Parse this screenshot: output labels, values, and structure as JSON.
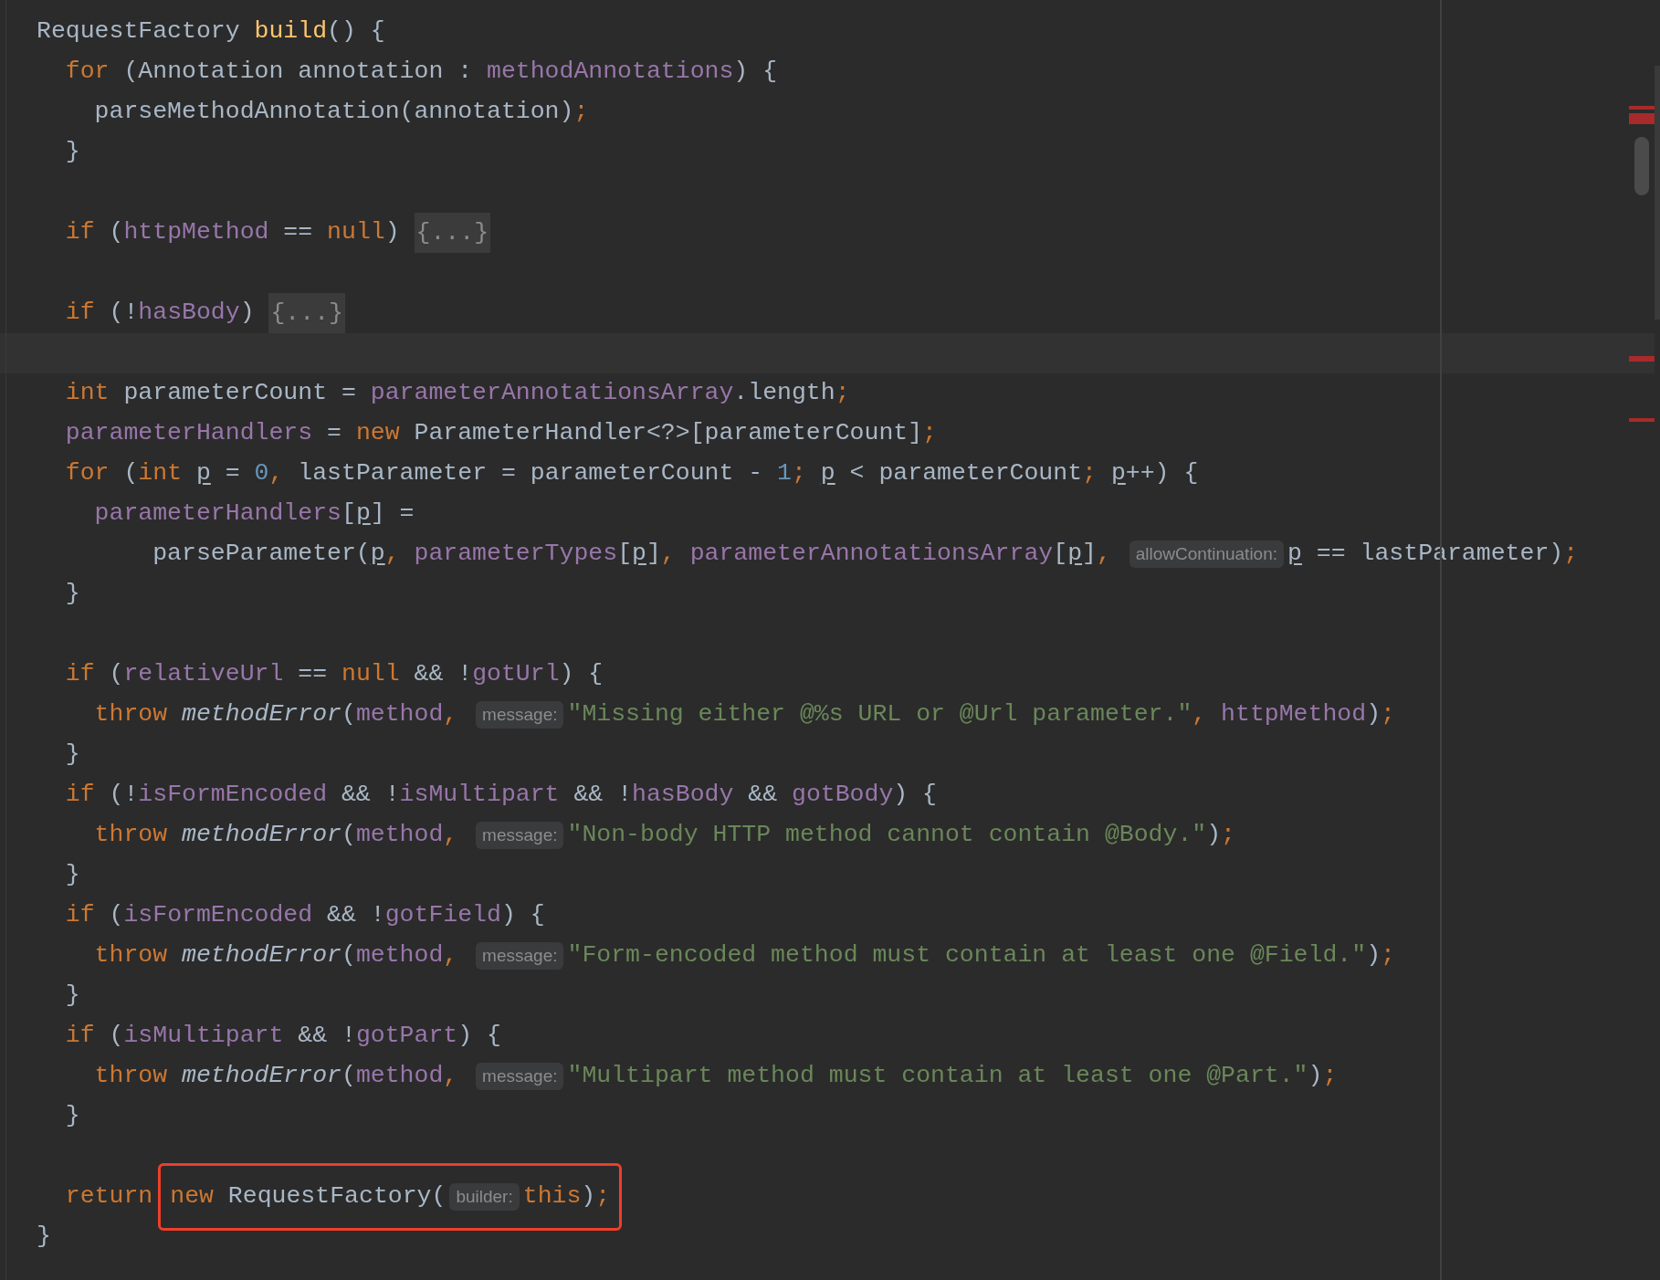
{
  "editor": {
    "lines": [
      {
        "current": false,
        "tokens": [
          {
            "kind": "plain",
            "text": "RequestFactory "
          },
          {
            "kind": "decl",
            "text": "build"
          },
          {
            "kind": "plain",
            "text": "() {"
          }
        ]
      },
      {
        "current": false,
        "tokens": [
          {
            "kind": "kw",
            "text": "  for "
          },
          {
            "kind": "plain",
            "text": "(Annotation annotation : "
          },
          {
            "kind": "field",
            "text": "methodAnnotations"
          },
          {
            "kind": "plain",
            "text": ") {"
          }
        ]
      },
      {
        "current": false,
        "tokens": [
          {
            "kind": "plain",
            "text": "    parseMethodAnnotation(annotation)"
          },
          {
            "kind": "kw",
            "text": ";"
          }
        ]
      },
      {
        "current": false,
        "tokens": [
          {
            "kind": "plain",
            "text": "  }"
          }
        ]
      },
      {
        "current": false
      },
      {
        "current": false,
        "tokens": [
          {
            "kind": "kw",
            "text": "  if "
          },
          {
            "kind": "plain",
            "text": "("
          },
          {
            "kind": "field",
            "text": "httpMethod"
          },
          {
            "kind": "plain",
            "text": " == "
          },
          {
            "kind": "kw",
            "text": "null"
          },
          {
            "kind": "plain",
            "text": ") "
          },
          {
            "kind": "fold",
            "text": "{...}"
          }
        ]
      },
      {
        "current": false
      },
      {
        "current": false,
        "tokens": [
          {
            "kind": "kw",
            "text": "  if "
          },
          {
            "kind": "plain",
            "text": "(!"
          },
          {
            "kind": "field",
            "text": "hasBody"
          },
          {
            "kind": "plain",
            "text": ") "
          },
          {
            "kind": "fold",
            "text": "{...}"
          }
        ]
      },
      {
        "current": true
      },
      {
        "current": false,
        "tokens": [
          {
            "kind": "kw",
            "text": "  int "
          },
          {
            "kind": "plain",
            "text": "parameterCount = "
          },
          {
            "kind": "field",
            "text": "parameterAnnotationsArray"
          },
          {
            "kind": "plain",
            "text": ".length"
          },
          {
            "kind": "kw",
            "text": ";"
          }
        ]
      },
      {
        "current": false,
        "tokens": [
          {
            "kind": "field",
            "text": "  parameterHandlers"
          },
          {
            "kind": "plain",
            "text": " = "
          },
          {
            "kind": "kw",
            "text": "new "
          },
          {
            "kind": "plain",
            "text": "ParameterHandler<?>[parameterCount]"
          },
          {
            "kind": "kw",
            "text": ";"
          }
        ]
      },
      {
        "current": false,
        "tokens": [
          {
            "kind": "kw",
            "text": "  for "
          },
          {
            "kind": "plain",
            "text": "("
          },
          {
            "kind": "kw",
            "text": "int "
          },
          {
            "kind": "var",
            "text": "p"
          },
          {
            "kind": "plain",
            "text": " = "
          },
          {
            "kind": "num",
            "text": "0"
          },
          {
            "kind": "kw",
            "text": ", "
          },
          {
            "kind": "plain",
            "text": "lastParameter = parameterCount - "
          },
          {
            "kind": "num",
            "text": "1"
          },
          {
            "kind": "kw",
            "text": "; "
          },
          {
            "kind": "var",
            "text": "p"
          },
          {
            "kind": "plain",
            "text": " < parameterCount"
          },
          {
            "kind": "kw",
            "text": "; "
          },
          {
            "kind": "var",
            "text": "p"
          },
          {
            "kind": "plain",
            "text": "++) {"
          }
        ]
      },
      {
        "current": false,
        "tokens": [
          {
            "kind": "field",
            "text": "    parameterHandlers"
          },
          {
            "kind": "plain",
            "text": "["
          },
          {
            "kind": "var",
            "text": "p"
          },
          {
            "kind": "plain",
            "text": "] ="
          }
        ]
      },
      {
        "current": false,
        "tokens": [
          {
            "kind": "plain",
            "text": "        parseParameter("
          },
          {
            "kind": "var",
            "text": "p"
          },
          {
            "kind": "kw",
            "text": ", "
          },
          {
            "kind": "field",
            "text": "parameterTypes"
          },
          {
            "kind": "plain",
            "text": "["
          },
          {
            "kind": "var",
            "text": "p"
          },
          {
            "kind": "plain",
            "text": "]"
          },
          {
            "kind": "kw",
            "text": ", "
          },
          {
            "kind": "field",
            "text": "parameterAnnotationsArray"
          },
          {
            "kind": "plain",
            "text": "["
          },
          {
            "kind": "var",
            "text": "p"
          },
          {
            "kind": "plain",
            "text": "]"
          },
          {
            "kind": "kw",
            "text": ", "
          },
          {
            "kind": "hint",
            "text": "allowContinuation:"
          },
          {
            "kind": "var",
            "text": "p"
          },
          {
            "kind": "plain",
            "text": " == lastParameter)"
          },
          {
            "kind": "kw",
            "text": ";"
          }
        ]
      },
      {
        "current": false,
        "tokens": [
          {
            "kind": "plain",
            "text": "  }"
          }
        ]
      },
      {
        "current": false
      },
      {
        "current": false,
        "tokens": [
          {
            "kind": "kw",
            "text": "  if "
          },
          {
            "kind": "plain",
            "text": "("
          },
          {
            "kind": "field",
            "text": "relativeUrl"
          },
          {
            "kind": "plain",
            "text": " == "
          },
          {
            "kind": "kw",
            "text": "null"
          },
          {
            "kind": "plain",
            "text": " && !"
          },
          {
            "kind": "field",
            "text": "gotUrl"
          },
          {
            "kind": "plain",
            "text": ") {"
          }
        ]
      },
      {
        "current": false,
        "tokens": [
          {
            "kind": "kw",
            "text": "    throw "
          },
          {
            "kind": "call",
            "text": "methodError"
          },
          {
            "kind": "plain",
            "text": "("
          },
          {
            "kind": "field",
            "text": "method"
          },
          {
            "kind": "kw",
            "text": ", "
          },
          {
            "kind": "hint",
            "text": "message:"
          },
          {
            "kind": "str",
            "text": "\"Missing either @%s URL or @Url parameter.\""
          },
          {
            "kind": "kw",
            "text": ", "
          },
          {
            "kind": "field",
            "text": "httpMethod"
          },
          {
            "kind": "plain",
            "text": ")"
          },
          {
            "kind": "kw",
            "text": ";"
          }
        ]
      },
      {
        "current": false,
        "tokens": [
          {
            "kind": "plain",
            "text": "  }"
          }
        ]
      },
      {
        "current": false,
        "tokens": [
          {
            "kind": "kw",
            "text": "  if "
          },
          {
            "kind": "plain",
            "text": "(!"
          },
          {
            "kind": "field",
            "text": "isFormEncoded"
          },
          {
            "kind": "plain",
            "text": " && !"
          },
          {
            "kind": "field",
            "text": "isMultipart"
          },
          {
            "kind": "plain",
            "text": " && !"
          },
          {
            "kind": "field",
            "text": "hasBody"
          },
          {
            "kind": "plain",
            "text": " && "
          },
          {
            "kind": "field",
            "text": "gotBody"
          },
          {
            "kind": "plain",
            "text": ") {"
          }
        ]
      },
      {
        "current": false,
        "tokens": [
          {
            "kind": "kw",
            "text": "    throw "
          },
          {
            "kind": "call",
            "text": "methodError"
          },
          {
            "kind": "plain",
            "text": "("
          },
          {
            "kind": "field",
            "text": "method"
          },
          {
            "kind": "kw",
            "text": ", "
          },
          {
            "kind": "hint",
            "text": "message:"
          },
          {
            "kind": "str",
            "text": "\"Non-body HTTP method cannot contain @Body.\""
          },
          {
            "kind": "plain",
            "text": ")"
          },
          {
            "kind": "kw",
            "text": ";"
          }
        ]
      },
      {
        "current": false,
        "tokens": [
          {
            "kind": "plain",
            "text": "  }"
          }
        ]
      },
      {
        "current": false,
        "tokens": [
          {
            "kind": "kw",
            "text": "  if "
          },
          {
            "kind": "plain",
            "text": "("
          },
          {
            "kind": "field",
            "text": "isFormEncoded"
          },
          {
            "kind": "plain",
            "text": " && !"
          },
          {
            "kind": "field",
            "text": "gotField"
          },
          {
            "kind": "plain",
            "text": ") {"
          }
        ]
      },
      {
        "current": false,
        "tokens": [
          {
            "kind": "kw",
            "text": "    throw "
          },
          {
            "kind": "call",
            "text": "methodError"
          },
          {
            "kind": "plain",
            "text": "("
          },
          {
            "kind": "field",
            "text": "method"
          },
          {
            "kind": "kw",
            "text": ", "
          },
          {
            "kind": "hint",
            "text": "message:"
          },
          {
            "kind": "str",
            "text": "\"Form-encoded method must contain at least one @Field.\""
          },
          {
            "kind": "plain",
            "text": ")"
          },
          {
            "kind": "kw",
            "text": ";"
          }
        ]
      },
      {
        "current": false,
        "tokens": [
          {
            "kind": "plain",
            "text": "  }"
          }
        ]
      },
      {
        "current": false,
        "tokens": [
          {
            "kind": "kw",
            "text": "  if "
          },
          {
            "kind": "plain",
            "text": "("
          },
          {
            "kind": "field",
            "text": "isMultipart"
          },
          {
            "kind": "plain",
            "text": " && !"
          },
          {
            "kind": "field",
            "text": "gotPart"
          },
          {
            "kind": "plain",
            "text": ") {"
          }
        ]
      },
      {
        "current": false,
        "tokens": [
          {
            "kind": "kw",
            "text": "    throw "
          },
          {
            "kind": "call",
            "text": "methodError"
          },
          {
            "kind": "plain",
            "text": "("
          },
          {
            "kind": "field",
            "text": "method"
          },
          {
            "kind": "kw",
            "text": ", "
          },
          {
            "kind": "hint",
            "text": "message:"
          },
          {
            "kind": "str",
            "text": "\"Multipart method must contain at least one @Part.\""
          },
          {
            "kind": "plain",
            "text": ")"
          },
          {
            "kind": "kw",
            "text": ";"
          }
        ]
      },
      {
        "current": false,
        "tokens": [
          {
            "kind": "plain",
            "text": "  }"
          }
        ]
      },
      {
        "current": false
      },
      {
        "current": false,
        "tokens": [
          {
            "kind": "kw",
            "text": "  return"
          }
        ],
        "boxed": [
          {
            "kind": "kw",
            "text": "new "
          },
          {
            "kind": "plain",
            "text": "RequestFactory("
          },
          {
            "kind": "hint",
            "text": "builder:"
          },
          {
            "kind": "kw",
            "text": "this"
          },
          {
            "kind": "plain",
            "text": ")"
          },
          {
            "kind": "kw",
            "text": ";"
          }
        ]
      },
      {
        "current": false,
        "tokens": [
          {
            "kind": "plain",
            "text": "}"
          }
        ]
      }
    ]
  }
}
